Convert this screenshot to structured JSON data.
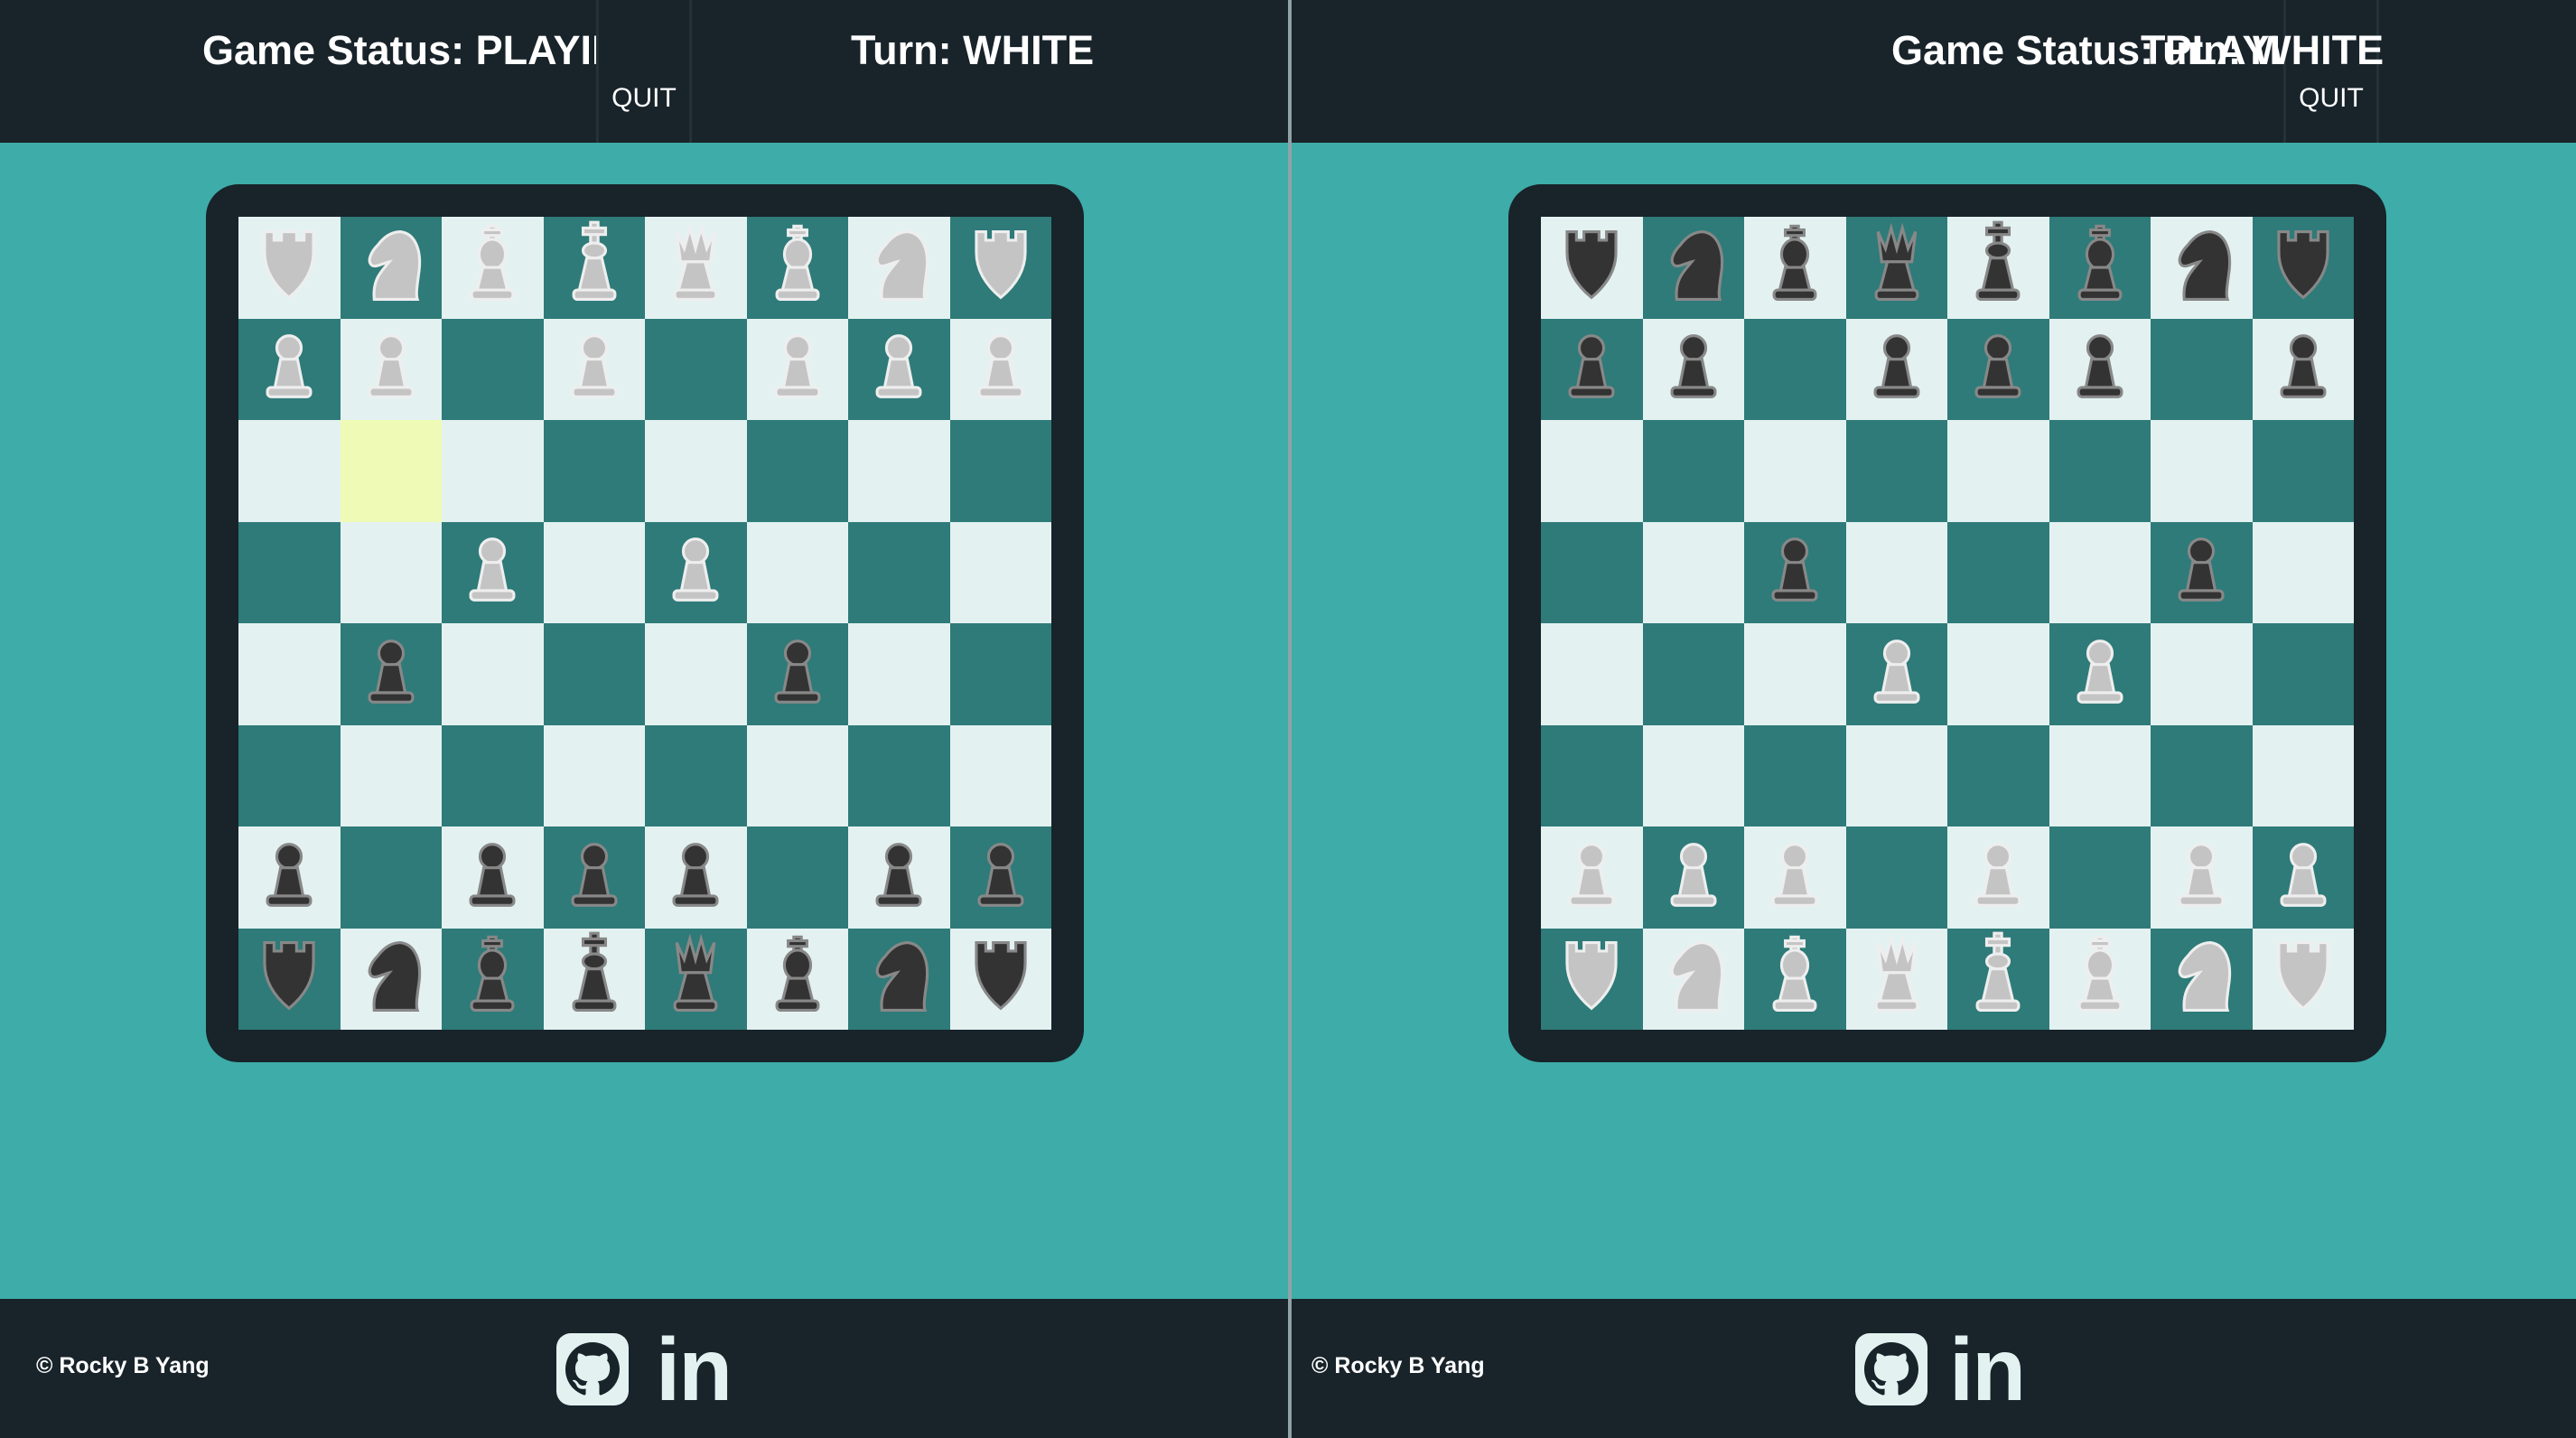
{
  "header": {
    "status_label": "Game Status: PLAYING",
    "quit_label": "QUIT",
    "turn_label": "Turn: WHITE"
  },
  "footer": {
    "copyright": "© Rocky B Yang",
    "github_icon": "github-icon",
    "linkedin_label": "in"
  },
  "colors": {
    "background": "#3eaca8",
    "bar": "#18232a",
    "light_square": "#e3f2f1",
    "dark_square": "#2e7b79",
    "highlight": "#eefab5",
    "white_piece": "#c4c4c4",
    "black_piece": "#333333"
  },
  "boards": [
    {
      "orientation": "black-bottom",
      "highlight": "b6",
      "rows": [
        [
          "wR",
          "wN",
          "wB",
          "wK",
          "wQ",
          "wB",
          "wN",
          "wR"
        ],
        [
          "wP",
          "wP",
          "",
          "wP",
          "",
          "wP",
          "wP",
          "wP"
        ],
        [
          "",
          "",
          "",
          "",
          "",
          "",
          "",
          ""
        ],
        [
          "",
          "",
          "wP",
          "",
          "wP",
          "",
          "",
          ""
        ],
        [
          "",
          "bP",
          "",
          "",
          "",
          "bP",
          "",
          ""
        ],
        [
          "",
          "",
          "",
          "",
          "",
          "",
          "",
          ""
        ],
        [
          "bP",
          "",
          "bP",
          "bP",
          "bP",
          "",
          "bP",
          "bP"
        ],
        [
          "bR",
          "bN",
          "bB",
          "bK",
          "bQ",
          "bB",
          "bN",
          "bR"
        ]
      ]
    },
    {
      "orientation": "white-bottom",
      "highlight": "",
      "rows": [
        [
          "bR",
          "bN",
          "bB",
          "bQ",
          "bK",
          "bB",
          "bN",
          "bR"
        ],
        [
          "bP",
          "bP",
          "",
          "bP",
          "bP",
          "bP",
          "",
          "bP"
        ],
        [
          "",
          "",
          "",
          "",
          "",
          "",
          "",
          ""
        ],
        [
          "",
          "",
          "bP",
          "",
          "",
          "",
          "bP",
          ""
        ],
        [
          "",
          "",
          "",
          "wP",
          "",
          "wP",
          "",
          ""
        ],
        [
          "",
          "",
          "",
          "",
          "",
          "",
          "",
          ""
        ],
        [
          "wP",
          "wP",
          "wP",
          "",
          "wP",
          "",
          "wP",
          "wP"
        ],
        [
          "wR",
          "wN",
          "wB",
          "wQ",
          "wK",
          "wB",
          "wN",
          "wR"
        ]
      ]
    }
  ]
}
